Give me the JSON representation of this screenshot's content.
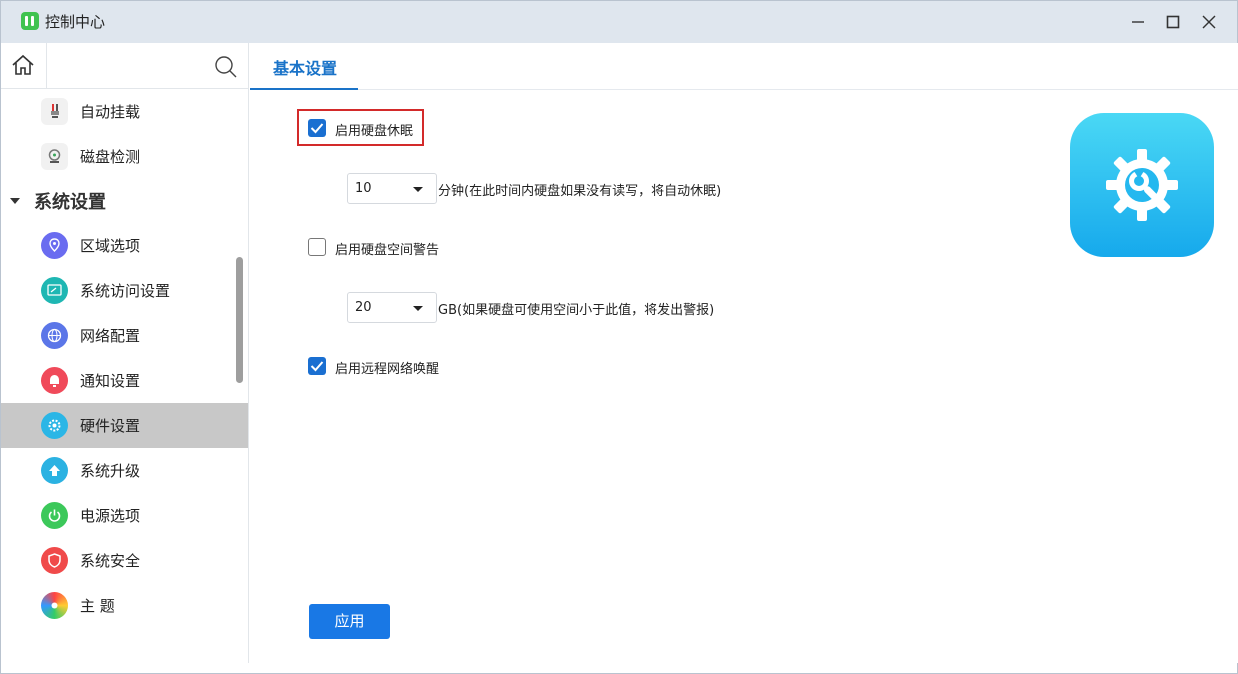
{
  "window": {
    "title": "控制中心"
  },
  "sidebar": {
    "items_top": [
      {
        "label": "自动挂载",
        "icon": "usb-icon"
      },
      {
        "label": "磁盘检测",
        "icon": "disk-check-icon"
      }
    ],
    "group": {
      "label": "系统设置",
      "expanded": true
    },
    "items": [
      {
        "label": "区域选项",
        "icon": "region-icon",
        "color": "#6a6cf0"
      },
      {
        "label": "系统访问设置",
        "icon": "access-icon",
        "color": "#1fb7b3"
      },
      {
        "label": "网络配置",
        "icon": "network-icon",
        "color": "#5b76e8"
      },
      {
        "label": "通知设置",
        "icon": "notification-icon",
        "color": "#f04a5a"
      },
      {
        "label": "硬件设置",
        "icon": "hardware-icon",
        "color": "#2bb6e6",
        "active": true
      },
      {
        "label": "系统升级",
        "icon": "upgrade-icon",
        "color": "#2bb2e2"
      },
      {
        "label": "电源选项",
        "icon": "power-icon",
        "color": "#3cc85a"
      },
      {
        "label": "系统安全",
        "icon": "security-icon",
        "color": "#f04a4a"
      },
      {
        "label": "主 题",
        "icon": "theme-icon"
      }
    ]
  },
  "main": {
    "tab": {
      "label": "基本设置"
    },
    "settings": {
      "disk_sleep": {
        "label": "启用硬盘休眠",
        "checked": true
      },
      "sleep_minutes": {
        "value": "10",
        "hint": "分钟(在此时间内硬盘如果没有读写，将自动休眠)"
      },
      "space_warning": {
        "label": "启用硬盘空间警告",
        "checked": false
      },
      "space_gb": {
        "value": "20",
        "hint": "GB(如果硬盘可使用空间小于此值，将发出警报)"
      },
      "wake_on_lan": {
        "label": "启用远程网络唤醒",
        "checked": true
      }
    },
    "apply_label": "应用",
    "hero_icon": "hardware-settings-gear-icon"
  },
  "colors": {
    "accent": "#1a73c8",
    "button": "#1978e5",
    "highlight": "#d32a2a"
  }
}
